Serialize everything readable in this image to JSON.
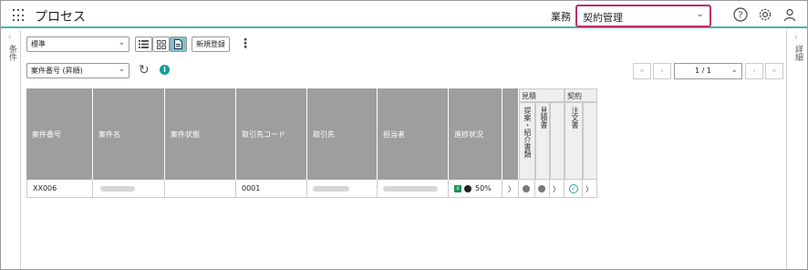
{
  "header": {
    "title": "プロセス",
    "business_label": "業務",
    "business_value": "契約管理"
  },
  "left_panel": {
    "label": "条件"
  },
  "right_panel": {
    "label": "詳細"
  },
  "toolbar": {
    "view_select": "標準",
    "new_button": "新規登録",
    "sort_select": "案件番号 (昇順)"
  },
  "pager": {
    "page_value": "1 / 1"
  },
  "table": {
    "columns": [
      "案件番号",
      "案件名",
      "案件状態",
      "取引先コード",
      "取引先",
      "担当者",
      "進捗状況"
    ],
    "groups": {
      "estimate": "見積",
      "contract": "契約"
    },
    "sub_columns": {
      "proposal": "提案・紹介書類",
      "estimate_doc": "見積書",
      "order_doc": "注文書"
    },
    "rows": [
      {
        "case_no": "XX006",
        "client_code": "0001",
        "progress": "50%"
      }
    ]
  },
  "colors": {
    "accent": "#3fb6b0",
    "highlight_border": "#b9306a",
    "header_gray": "#9e9e9e",
    "info": "#149c9c"
  }
}
